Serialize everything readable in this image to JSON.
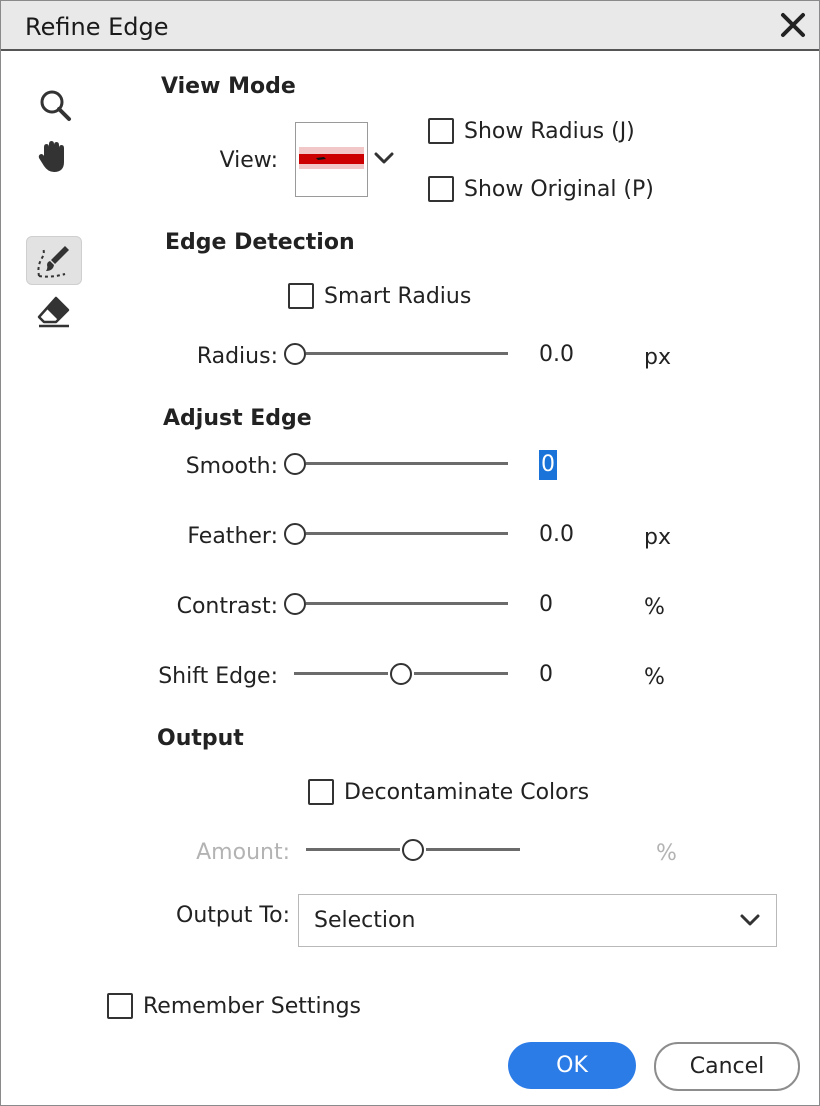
{
  "window": {
    "title": "Refine Edge"
  },
  "tools": [
    {
      "name": "zoom-icon"
    },
    {
      "name": "hand-icon"
    },
    {
      "name": "refine-radius-brush-icon",
      "selected": true
    },
    {
      "name": "eraser-icon"
    }
  ],
  "view_mode": {
    "heading": "View Mode",
    "view_label": "View:",
    "show_radius_label": "Show Radius (J)",
    "show_radius_checked": false,
    "show_original_label": "Show Original (P)",
    "show_original_checked": false
  },
  "edge_detection": {
    "heading": "Edge Detection",
    "smart_radius_label": "Smart Radius",
    "smart_radius_checked": false,
    "radius": {
      "label": "Radius:",
      "value": "0.0",
      "unit": "px",
      "level": 0
    }
  },
  "adjust_edge": {
    "heading": "Adjust Edge",
    "smooth": {
      "label": "Smooth:",
      "value": "0",
      "unit": "",
      "level": 0
    },
    "feather": {
      "label": "Feather:",
      "value": "0.0",
      "unit": "px",
      "level": 0
    },
    "contrast": {
      "label": "Contrast:",
      "value": "0",
      "unit": "%",
      "level": 0
    },
    "shift": {
      "label": "Shift Edge:",
      "value": "0",
      "unit": "%",
      "level": 0.5
    }
  },
  "output": {
    "heading": "Output",
    "decontaminate_label": "Decontaminate Colors",
    "decontaminate_checked": false,
    "amount": {
      "label": "Amount:",
      "unit": "%",
      "level": 0.5,
      "disabled": true
    },
    "output_to_label": "Output To:",
    "output_to_value": "Selection"
  },
  "remember_label": "Remember Settings",
  "remember_checked": false,
  "buttons": {
    "ok": "OK",
    "cancel": "Cancel"
  },
  "colors": {
    "accent": "#2c7ce8",
    "selection": "#1a73d8",
    "preview_red": "#cc0000"
  }
}
